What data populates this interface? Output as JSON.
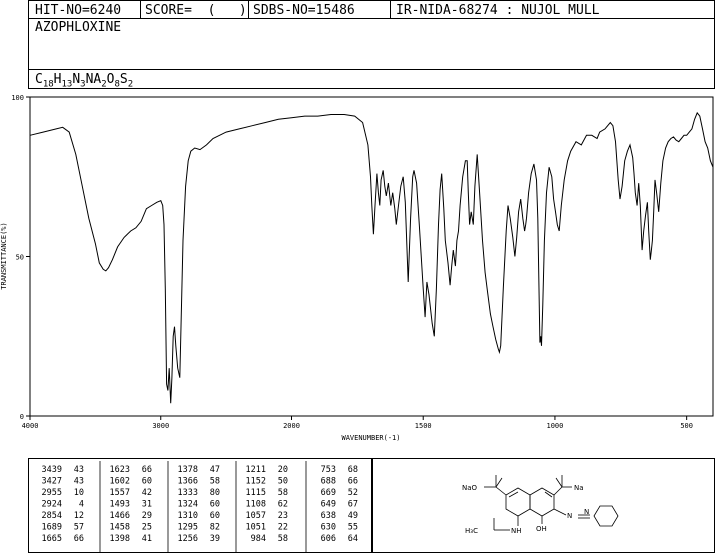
{
  "header": {
    "hit_no": "HIT-NO=6240",
    "score": "SCORE=  (   )",
    "sdbs_no": "SDBS-NO=15486",
    "ir_info": "IR-NIDA-68274 : NUJOL MULL"
  },
  "compound": {
    "name": "AZOPHLOXINE",
    "formula": [
      {
        "t": "C"
      },
      {
        "s": "18"
      },
      {
        "t": "H"
      },
      {
        "s": "13"
      },
      {
        "t": "N"
      },
      {
        "s": "3"
      },
      {
        "t": "NA"
      },
      {
        "s": "2"
      },
      {
        "t": "O"
      },
      {
        "s": "8"
      },
      {
        "t": "S"
      },
      {
        "s": "2"
      }
    ]
  },
  "structure": {
    "labels": [
      "NaO",
      "Na",
      "H₃C",
      "NH",
      "OH",
      "N",
      "N"
    ]
  },
  "peak_table": {
    "columns": [
      [
        [
          "3439",
          "43"
        ],
        [
          "3427",
          "43"
        ],
        [
          "2955",
          "10"
        ],
        [
          "2924",
          "4"
        ],
        [
          "2854",
          "12"
        ],
        [
          "1689",
          "57"
        ],
        [
          "1665",
          "66"
        ]
      ],
      [
        [
          "1623",
          "66"
        ],
        [
          "1602",
          "60"
        ],
        [
          "1557",
          "42"
        ],
        [
          "1493",
          "31"
        ],
        [
          "1466",
          "29"
        ],
        [
          "1458",
          "25"
        ],
        [
          "1398",
          "41"
        ]
      ],
      [
        [
          "1378",
          "47"
        ],
        [
          "1366",
          "58"
        ],
        [
          "1333",
          "80"
        ],
        [
          "1324",
          "60"
        ],
        [
          "1310",
          "60"
        ],
        [
          "1295",
          "82"
        ],
        [
          "1256",
          "39"
        ]
      ],
      [
        [
          "1211",
          "20"
        ],
        [
          "1152",
          "50"
        ],
        [
          "1115",
          "58"
        ],
        [
          "1108",
          "62"
        ],
        [
          "1057",
          "23"
        ],
        [
          "1051",
          "22"
        ],
        [
          "984",
          "58"
        ]
      ],
      [
        [
          "753",
          "68"
        ],
        [
          "688",
          "66"
        ],
        [
          "669",
          "52"
        ],
        [
          "649",
          "67"
        ],
        [
          "638",
          "49"
        ],
        [
          "630",
          "55"
        ],
        [
          "606",
          "64"
        ]
      ]
    ]
  },
  "chart_data": {
    "type": "line",
    "title": "",
    "xlabel": "WAVENUMBER(-1)",
    "ylabel": "TRANSMITTANCE(%)",
    "xlim": [
      4000,
      400
    ],
    "ylim": [
      0,
      100
    ],
    "x_ticks": [
      4000,
      3000,
      2000,
      1500,
      1000,
      500
    ],
    "y_ticks": [
      0,
      50,
      100
    ],
    "grid": false,
    "series": [
      {
        "points": [
          [
            4000,
            88
          ],
          [
            3900,
            89
          ],
          [
            3800,
            90
          ],
          [
            3750,
            90.5
          ],
          [
            3700,
            89
          ],
          [
            3650,
            82
          ],
          [
            3600,
            72
          ],
          [
            3550,
            62
          ],
          [
            3500,
            54
          ],
          [
            3470,
            48
          ],
          [
            3440,
            46
          ],
          [
            3420,
            45.5
          ],
          [
            3400,
            46.5
          ],
          [
            3370,
            49
          ],
          [
            3330,
            53
          ],
          [
            3280,
            56
          ],
          [
            3230,
            58
          ],
          [
            3190,
            59
          ],
          [
            3150,
            61
          ],
          [
            3110,
            65
          ],
          [
            3070,
            66
          ],
          [
            3030,
            67
          ],
          [
            3000,
            67.5
          ],
          [
            2985,
            66
          ],
          [
            2975,
            60
          ],
          [
            2965,
            40
          ],
          [
            2955,
            10
          ],
          [
            2945,
            8
          ],
          [
            2935,
            15
          ],
          [
            2924,
            4
          ],
          [
            2915,
            12
          ],
          [
            2905,
            25
          ],
          [
            2895,
            28
          ],
          [
            2885,
            22
          ],
          [
            2870,
            15
          ],
          [
            2854,
            12
          ],
          [
            2845,
            28
          ],
          [
            2830,
            55
          ],
          [
            2810,
            72
          ],
          [
            2790,
            80
          ],
          [
            2770,
            83
          ],
          [
            2740,
            84
          ],
          [
            2700,
            83.5
          ],
          [
            2650,
            85
          ],
          [
            2600,
            87
          ],
          [
            2500,
            89
          ],
          [
            2400,
            90
          ],
          [
            2300,
            91
          ],
          [
            2200,
            92
          ],
          [
            2100,
            93
          ],
          [
            2000,
            93.5
          ],
          [
            1950,
            94
          ],
          [
            1900,
            94
          ],
          [
            1850,
            94.5
          ],
          [
            1800,
            94.5
          ],
          [
            1760,
            94
          ],
          [
            1730,
            92
          ],
          [
            1710,
            85
          ],
          [
            1700,
            75
          ],
          [
            1695,
            66
          ],
          [
            1689,
            57
          ],
          [
            1683,
            66
          ],
          [
            1676,
            76
          ],
          [
            1670,
            70
          ],
          [
            1665,
            66
          ],
          [
            1660,
            74
          ],
          [
            1652,
            77
          ],
          [
            1646,
            72
          ],
          [
            1640,
            69
          ],
          [
            1632,
            73
          ],
          [
            1623,
            66
          ],
          [
            1616,
            70
          ],
          [
            1608,
            65
          ],
          [
            1602,
            60
          ],
          [
            1594,
            66
          ],
          [
            1585,
            72
          ],
          [
            1576,
            75
          ],
          [
            1568,
            67
          ],
          [
            1557,
            42
          ],
          [
            1548,
            62
          ],
          [
            1540,
            75
          ],
          [
            1535,
            77
          ],
          [
            1525,
            73
          ],
          [
            1515,
            60
          ],
          [
            1500,
            40
          ],
          [
            1493,
            31
          ],
          [
            1486,
            42
          ],
          [
            1478,
            38
          ],
          [
            1466,
            29
          ],
          [
            1458,
            25
          ],
          [
            1450,
            40
          ],
          [
            1442,
            60
          ],
          [
            1436,
            71
          ],
          [
            1430,
            76
          ],
          [
            1422,
            65
          ],
          [
            1416,
            55
          ],
          [
            1406,
            48
          ],
          [
            1398,
            41
          ],
          [
            1392,
            47
          ],
          [
            1386,
            52
          ],
          [
            1378,
            47
          ],
          [
            1372,
            55
          ],
          [
            1366,
            58
          ],
          [
            1360,
            66
          ],
          [
            1350,
            75
          ],
          [
            1340,
            80
          ],
          [
            1333,
            80
          ],
          [
            1329,
            70
          ],
          [
            1324,
            60
          ],
          [
            1318,
            64
          ],
          [
            1310,
            60
          ],
          [
            1304,
            72
          ],
          [
            1295,
            82
          ],
          [
            1286,
            70
          ],
          [
            1275,
            55
          ],
          [
            1265,
            45
          ],
          [
            1256,
            39
          ],
          [
            1245,
            32
          ],
          [
            1235,
            28
          ],
          [
            1225,
            24
          ],
          [
            1215,
            21
          ],
          [
            1211,
            20
          ],
          [
            1206,
            22
          ],
          [
            1196,
            40
          ],
          [
            1185,
            58
          ],
          [
            1178,
            66
          ],
          [
            1170,
            62
          ],
          [
            1160,
            56
          ],
          [
            1152,
            50
          ],
          [
            1145,
            56
          ],
          [
            1138,
            64
          ],
          [
            1130,
            68
          ],
          [
            1122,
            62
          ],
          [
            1115,
            58
          ],
          [
            1111,
            60
          ],
          [
            1108,
            62
          ],
          [
            1100,
            70
          ],
          [
            1090,
            76
          ],
          [
            1080,
            79
          ],
          [
            1070,
            74
          ],
          [
            1065,
            62
          ],
          [
            1057,
            23
          ],
          [
            1054,
            25
          ],
          [
            1051,
            22
          ],
          [
            1046,
            35
          ],
          [
            1040,
            55
          ],
          [
            1032,
            70
          ],
          [
            1022,
            78
          ],
          [
            1012,
            75
          ],
          [
            1005,
            68
          ],
          [
            998,
            64
          ],
          [
            991,
            60
          ],
          [
            984,
            58
          ],
          [
            976,
            66
          ],
          [
            965,
            74
          ],
          [
            952,
            80
          ],
          [
            940,
            83
          ],
          [
            920,
            86
          ],
          [
            900,
            85
          ],
          [
            880,
            88
          ],
          [
            860,
            88
          ],
          [
            840,
            87
          ],
          [
            830,
            89
          ],
          [
            810,
            90
          ],
          [
            790,
            92
          ],
          [
            780,
            91
          ],
          [
            770,
            86
          ],
          [
            760,
            74
          ],
          [
            753,
            68
          ],
          [
            745,
            72
          ],
          [
            735,
            80
          ],
          [
            725,
            83
          ],
          [
            715,
            85
          ],
          [
            705,
            81
          ],
          [
            700,
            76
          ],
          [
            695,
            70
          ],
          [
            688,
            66
          ],
          [
            682,
            73
          ],
          [
            676,
            66
          ],
          [
            669,
            52
          ],
          [
            663,
            58
          ],
          [
            656,
            63
          ],
          [
            649,
            67
          ],
          [
            644,
            58
          ],
          [
            638,
            49
          ],
          [
            634,
            52
          ],
          [
            630,
            55
          ],
          [
            625,
            64
          ],
          [
            620,
            74
          ],
          [
            614,
            70
          ],
          [
            606,
            64
          ],
          [
            598,
            73
          ],
          [
            590,
            80
          ],
          [
            580,
            84
          ],
          [
            570,
            86
          ],
          [
            560,
            87
          ],
          [
            550,
            87.5
          ],
          [
            540,
            86.5
          ],
          [
            530,
            86
          ],
          [
            520,
            87
          ],
          [
            510,
            88
          ],
          [
            500,
            88
          ],
          [
            490,
            89
          ],
          [
            480,
            90
          ],
          [
            470,
            93
          ],
          [
            460,
            95
          ],
          [
            450,
            94
          ],
          [
            440,
            90
          ],
          [
            430,
            86
          ],
          [
            420,
            84
          ],
          [
            410,
            80
          ],
          [
            400,
            78
          ]
        ]
      }
    ]
  }
}
